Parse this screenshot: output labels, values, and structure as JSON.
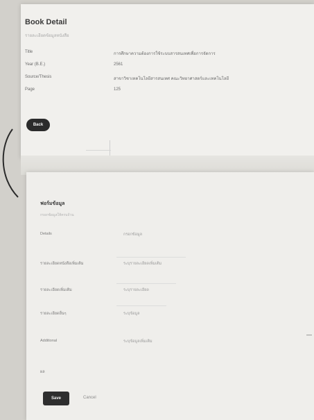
{
  "detail": {
    "title": "Book Detail",
    "subtitle": "รายละเอียดข้อมูลหนังสือ",
    "rows": [
      {
        "label": "Title",
        "value": "การศึกษาความต้องการใช้ระบบสารสนเทศเพื่อการจัดการ"
      },
      {
        "label": "Year (B.E.)",
        "value": "2561"
      },
      {
        "label": "Source/Thesis",
        "value": "สาขาวิชาเทคโนโลยีสารสนเทศ คณะวิทยาศาสตร์และเทคโนโลยี"
      },
      {
        "label": "Page",
        "value": "125"
      }
    ],
    "back_label": "Back"
  },
  "form": {
    "title": "ฟอร์มข้อมูล",
    "subtitle": "กรอกข้อมูลให้ครบถ้วน",
    "fields": [
      {
        "label": "Details",
        "value": "กรอกข้อมูล"
      },
      {
        "label": "รายละเอียดหนังสือเพิ่มเติม",
        "value": "ระบุรายละเอียดเพิ่มเติม"
      },
      {
        "label": "รายละเอียดเพิ่มเติม",
        "value": "ระบุรายละเอียด"
      },
      {
        "label": "รายละเอียดอื่นๆ",
        "value": "ระบุข้อมูล"
      },
      {
        "label": "Additional",
        "value": "ระบุข้อมูลเพิ่มเติม"
      },
      {
        "label": "ผล",
        "value": ""
      }
    ],
    "submit_label": "Save",
    "cancel_label": "Cancel"
  }
}
